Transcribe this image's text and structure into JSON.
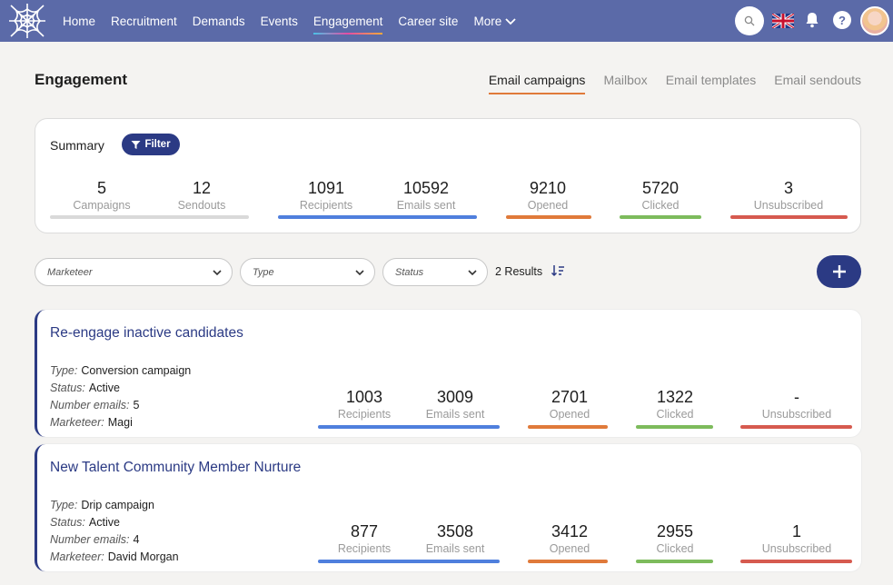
{
  "nav": {
    "items": [
      "Home",
      "Recruitment",
      "Demands",
      "Events",
      "Engagement",
      "Career site",
      "More"
    ],
    "active": "Engagement"
  },
  "page": {
    "title": "Engagement",
    "tabs": [
      "Email campaigns",
      "Mailbox",
      "Email templates",
      "Email sendouts"
    ],
    "active_tab": "Email campaigns"
  },
  "summary": {
    "label": "Summary",
    "filter_label": "Filter",
    "stats": {
      "campaigns": {
        "value": "5",
        "label": "Campaigns"
      },
      "sendouts": {
        "value": "12",
        "label": "Sendouts"
      },
      "recipients": {
        "value": "1091",
        "label": "Recipients"
      },
      "emails_sent": {
        "value": "10592",
        "label": "Emails sent"
      },
      "opened": {
        "value": "9210",
        "label": "Opened"
      },
      "clicked": {
        "value": "5720",
        "label": "Clicked"
      },
      "unsubscribed": {
        "value": "3",
        "label": "Unsubscribed"
      }
    }
  },
  "filters": {
    "marketeer_placeholder": "Marketeer",
    "type_placeholder": "Type",
    "status_placeholder": "Status",
    "results": "2 Results"
  },
  "meta_keys": {
    "type": "Type:",
    "status": "Status:",
    "number_emails": "Number emails:",
    "marketeer": "Marketeer:"
  },
  "campaigns": [
    {
      "title": "Re-engage inactive candidates",
      "type": "Conversion campaign",
      "status": "Active",
      "number_emails": "5",
      "marketeer": "Magi",
      "stats": {
        "recipients": {
          "value": "1003",
          "label": "Recipients"
        },
        "emails_sent": {
          "value": "3009",
          "label": "Emails sent"
        },
        "opened": {
          "value": "2701",
          "label": "Opened"
        },
        "clicked": {
          "value": "1322",
          "label": "Clicked"
        },
        "unsubscribed": {
          "value": "-",
          "label": "Unsubscribed"
        }
      }
    },
    {
      "title": "New Talent Community Member Nurture",
      "type": "Drip campaign",
      "status": "Active",
      "number_emails": "4",
      "marketeer": "David Morgan",
      "stats": {
        "recipients": {
          "value": "877",
          "label": "Recipients"
        },
        "emails_sent": {
          "value": "3508",
          "label": "Emails sent"
        },
        "opened": {
          "value": "3412",
          "label": "Opened"
        },
        "clicked": {
          "value": "2955",
          "label": "Clicked"
        },
        "unsubscribed": {
          "value": "1",
          "label": "Unsubscribed"
        }
      }
    }
  ],
  "colors": {
    "nav_bg": "#5b6aa8",
    "primary": "#2b3a84",
    "gray_bar": "#d9d9d9",
    "blue_bar": "#4f7fdd",
    "orange_bar": "#e07a3a",
    "green_bar": "#7dbb5c",
    "red_bar": "#d65a4f"
  }
}
